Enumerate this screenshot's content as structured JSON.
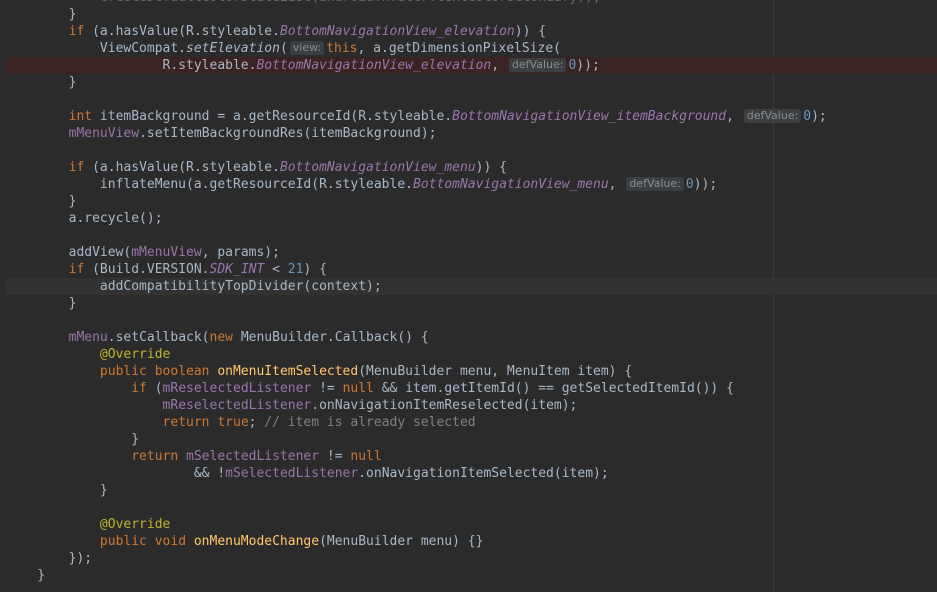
{
  "editor": {
    "lines": [
      {
        "state": "",
        "tokens": [
          [
            "            ",
            ""
          ],
          [
            "createDefaultColorStateList(android.R.attr.",
            "dim"
          ],
          [
            "textColorSecondary",
            "dim"
          ],
          [
            "));",
            "dim"
          ]
        ]
      },
      {
        "state": "",
        "tokens": [
          [
            "        }",
            ""
          ]
        ]
      },
      {
        "state": "",
        "tokens": [
          [
            "        ",
            ""
          ],
          [
            "if",
            "kw"
          ],
          [
            " (a.hasValue(R.styleable.",
            ""
          ],
          [
            "BottomNavigationView_elevation",
            "ifld"
          ],
          [
            ")) {",
            ""
          ]
        ]
      },
      {
        "state": "",
        "tokens": [
          [
            "            ViewCompat.",
            ""
          ],
          [
            "setElevation",
            "ital"
          ],
          [
            "(",
            ""
          ],
          [
            "view:",
            "hint"
          ],
          [
            "this",
            "kw"
          ],
          [
            ", a.getDimensionPixelSize(",
            ""
          ]
        ]
      },
      {
        "state": "error",
        "tokens": [
          [
            "                    R.styleable.",
            ""
          ],
          [
            "BottomNavigationView_elevation",
            "ifld"
          ],
          [
            ", ",
            ""
          ],
          [
            "defValue:",
            "hint"
          ],
          [
            "0",
            "num"
          ],
          [
            "));",
            ""
          ]
        ]
      },
      {
        "state": "",
        "tokens": [
          [
            "        }",
            ""
          ]
        ]
      },
      {
        "state": "",
        "tokens": [
          [
            "",
            ""
          ]
        ]
      },
      {
        "state": "",
        "tokens": [
          [
            "        ",
            ""
          ],
          [
            "int",
            "kw"
          ],
          [
            " itemBackground = a.getResourceId(R.styleable.",
            ""
          ],
          [
            "BottomNavigationView_itemBackground",
            "ifld"
          ],
          [
            ", ",
            ""
          ],
          [
            "defValue:",
            "hint"
          ],
          [
            "0",
            "num"
          ],
          [
            ");",
            ""
          ]
        ]
      },
      {
        "state": "",
        "tokens": [
          [
            "        ",
            ""
          ],
          [
            "mMenuView",
            "fld"
          ],
          [
            ".setItemBackgroundRes(itemBackground);",
            ""
          ]
        ]
      },
      {
        "state": "",
        "tokens": [
          [
            "",
            ""
          ]
        ]
      },
      {
        "state": "",
        "tokens": [
          [
            "        ",
            ""
          ],
          [
            "if",
            "kw"
          ],
          [
            " (a.hasValue(R.styleable.",
            ""
          ],
          [
            "BottomNavigationView_menu",
            "ifld"
          ],
          [
            ")) {",
            ""
          ]
        ]
      },
      {
        "state": "",
        "tokens": [
          [
            "            inflateMenu(a.getResourceId(R.styleable.",
            ""
          ],
          [
            "BottomNavigationView_menu",
            "ifld"
          ],
          [
            ", ",
            ""
          ],
          [
            "defValue:",
            "hint"
          ],
          [
            "0",
            "num"
          ],
          [
            "));",
            ""
          ]
        ]
      },
      {
        "state": "",
        "tokens": [
          [
            "        }",
            ""
          ]
        ]
      },
      {
        "state": "",
        "tokens": [
          [
            "        a.recycle();",
            ""
          ]
        ]
      },
      {
        "state": "",
        "tokens": [
          [
            "",
            ""
          ]
        ]
      },
      {
        "state": "",
        "tokens": [
          [
            "        addView(",
            ""
          ],
          [
            "mMenuView",
            "fld"
          ],
          [
            ", params);",
            ""
          ]
        ]
      },
      {
        "state": "",
        "tokens": [
          [
            "        ",
            ""
          ],
          [
            "if",
            "kw"
          ],
          [
            " (Build.VERSION.",
            ""
          ],
          [
            "SDK_INT",
            "ifld"
          ],
          [
            " < ",
            ""
          ],
          [
            "21",
            "num"
          ],
          [
            ") {",
            ""
          ]
        ]
      },
      {
        "state": "caret",
        "tokens": [
          [
            "            addCompatibilityTopDivider(context);",
            ""
          ]
        ]
      },
      {
        "state": "",
        "tokens": [
          [
            "        }",
            ""
          ]
        ]
      },
      {
        "state": "",
        "tokens": [
          [
            "",
            ""
          ]
        ]
      },
      {
        "state": "",
        "tokens": [
          [
            "        ",
            ""
          ],
          [
            "mMenu",
            "fld"
          ],
          [
            ".setCallback(",
            ""
          ],
          [
            "new",
            "kw"
          ],
          [
            " MenuBuilder.Callback() {",
            ""
          ]
        ]
      },
      {
        "state": "",
        "tokens": [
          [
            "            ",
            ""
          ],
          [
            "@Override",
            "ann"
          ]
        ]
      },
      {
        "state": "",
        "tokens": [
          [
            "            ",
            ""
          ],
          [
            "public boolean",
            "kw"
          ],
          [
            " ",
            ""
          ],
          [
            "onMenuItemSelected",
            "fn"
          ],
          [
            "(MenuBuilder menu, MenuItem item) {",
            ""
          ]
        ]
      },
      {
        "state": "",
        "tokens": [
          [
            "                ",
            ""
          ],
          [
            "if",
            "kw"
          ],
          [
            " (",
            ""
          ],
          [
            "mReselectedListener",
            "fld"
          ],
          [
            " != ",
            ""
          ],
          [
            "null",
            "kw"
          ],
          [
            " && item.getItemId() == getSelectedItemId()) {",
            ""
          ]
        ]
      },
      {
        "state": "",
        "tokens": [
          [
            "                    ",
            ""
          ],
          [
            "mReselectedListener",
            "fld"
          ],
          [
            ".onNavigationItemReselected(item);",
            ""
          ]
        ]
      },
      {
        "state": "",
        "tokens": [
          [
            "                    ",
            ""
          ],
          [
            "return true",
            "kw"
          ],
          [
            ";",
            ""
          ],
          [
            " // item is already selected",
            "cmt"
          ]
        ]
      },
      {
        "state": "",
        "tokens": [
          [
            "                }",
            ""
          ]
        ]
      },
      {
        "state": "",
        "tokens": [
          [
            "                ",
            ""
          ],
          [
            "return",
            "kw"
          ],
          [
            " ",
            ""
          ],
          [
            "mSelectedListener",
            "fld"
          ],
          [
            " != ",
            ""
          ],
          [
            "null",
            "kw"
          ]
        ]
      },
      {
        "state": "",
        "tokens": [
          [
            "                        && !",
            ""
          ],
          [
            "mSelectedListener",
            "fld"
          ],
          [
            ".onNavigationItemSelected(item);",
            ""
          ]
        ]
      },
      {
        "state": "",
        "tokens": [
          [
            "            }",
            ""
          ]
        ]
      },
      {
        "state": "",
        "tokens": [
          [
            "",
            ""
          ]
        ]
      },
      {
        "state": "",
        "tokens": [
          [
            "            ",
            ""
          ],
          [
            "@Override",
            "ann"
          ]
        ]
      },
      {
        "state": "",
        "tokens": [
          [
            "            ",
            ""
          ],
          [
            "public void",
            "kw"
          ],
          [
            " ",
            ""
          ],
          [
            "onMenuModeChange",
            "fn"
          ],
          [
            "(MenuBuilder menu) {}",
            ""
          ]
        ]
      },
      {
        "state": "",
        "tokens": [
          [
            "        });",
            ""
          ]
        ]
      },
      {
        "state": "",
        "tokens": [
          [
            "    }",
            ""
          ]
        ]
      }
    ]
  }
}
